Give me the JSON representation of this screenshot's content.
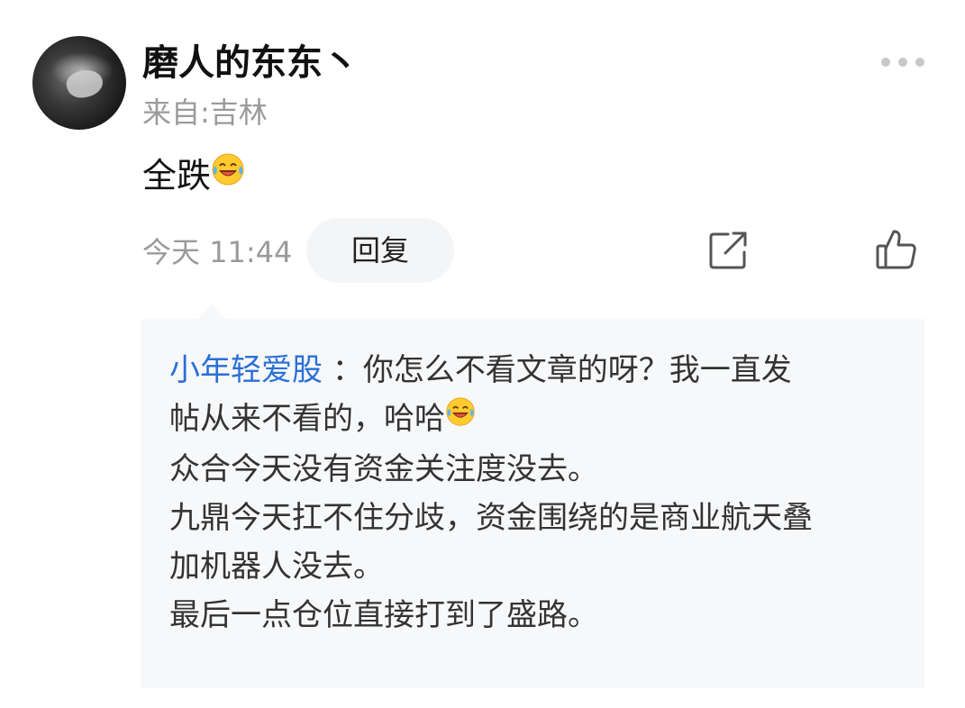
{
  "comment": {
    "username": "磨人的东东丶",
    "location": "来自:吉林",
    "content_text": "全跌",
    "content_emoji": "laughing-tears-emoji",
    "time": "今天 11:44",
    "reply_label": "回复",
    "icons": {
      "more": "more-dots-icon",
      "share": "share-icon",
      "like": "thumbs-up-icon"
    }
  },
  "quote": {
    "author": "小年轻爱股",
    "separator": "：",
    "lines": [
      "你怎么不看文章的呀？我一直发",
      "帖从来不看的，哈哈",
      "众合今天没有资金关注度没去。",
      "九鼎今天扛不住分歧，资金围绕的是商业航天叠",
      "加机器人没去。",
      "最后一点仓位直接打到了盛路。"
    ],
    "line2_emoji": "laughing-tears-emoji"
  },
  "colors": {
    "author_blue": "#2a6fd6",
    "muted_gray": "#9a9a9a",
    "quote_bg": "#f7f8fa",
    "button_bg": "#f4f5f7"
  }
}
